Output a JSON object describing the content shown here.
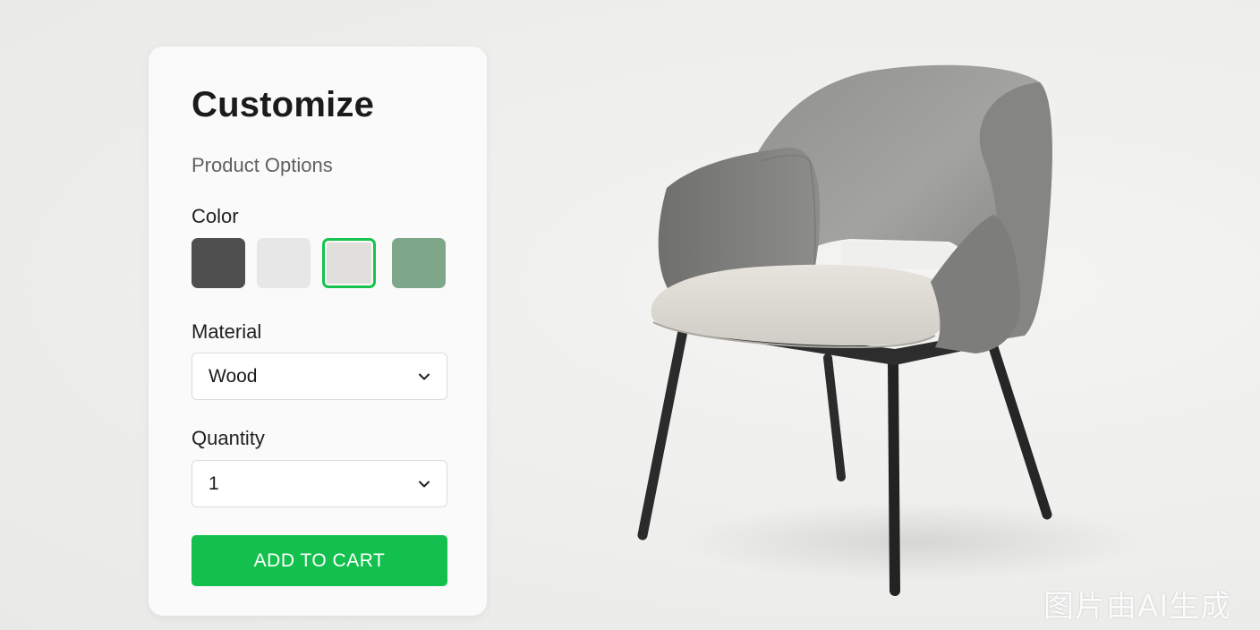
{
  "panel": {
    "title": "Customize",
    "subtitle": "Product Options",
    "color": {
      "label": "Color",
      "swatches": [
        {
          "name": "charcoal",
          "hex": "#4f4f4f",
          "selected": false
        },
        {
          "name": "light-gray",
          "hex": "#e7e7e7",
          "selected": false
        },
        {
          "name": "beige",
          "hex": "#e0dfdb",
          "selected": true
        },
        {
          "name": "sage-green",
          "hex": "#7ea78a",
          "selected": false
        }
      ]
    },
    "material": {
      "label": "Material",
      "value": "Wood"
    },
    "quantity": {
      "label": "Quantity",
      "value": "1"
    },
    "add_to_cart_label": "ADD TO CART"
  },
  "colors": {
    "accent": "#13c04d",
    "background": "#eeeeec",
    "panel": "#fafafa"
  },
  "icons": {
    "chevron": "chevron-down-icon"
  },
  "watermark": "图片由AI生成"
}
